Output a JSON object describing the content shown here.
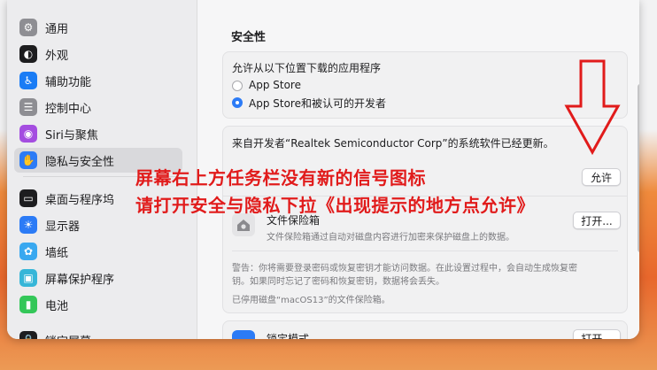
{
  "sidebar": {
    "items": [
      {
        "label": "通用",
        "icon": "gear-icon",
        "color": "#8e8e93"
      },
      {
        "label": "外观",
        "icon": "appearance-icon",
        "color": "#1d1d1f"
      },
      {
        "label": "辅助功能",
        "icon": "accessibility-icon",
        "color": "#1a7cf5"
      },
      {
        "label": "控制中心",
        "icon": "control-center-icon",
        "color": "#8e8e93"
      },
      {
        "label": "Siri与聚焦",
        "icon": "siri-icon",
        "color": "#a44de0"
      },
      {
        "label": "隐私与安全性",
        "icon": "privacy-hand-icon",
        "color": "#2c7bf6"
      },
      {
        "label": "桌面与程序坞",
        "icon": "dock-icon",
        "color": "#1d1d1f"
      },
      {
        "label": "显示器",
        "icon": "display-icon",
        "color": "#2c7bf6"
      },
      {
        "label": "墙纸",
        "icon": "wallpaper-icon",
        "color": "#39a8f0"
      },
      {
        "label": "屏幕保护程序",
        "icon": "screensaver-icon",
        "color": "#36b6d8"
      },
      {
        "label": "电池",
        "icon": "battery-icon",
        "color": "#34c759"
      },
      {
        "label": "锁定屏幕",
        "icon": "lock-screen-icon",
        "color": "#1d1d1f"
      }
    ]
  },
  "main": {
    "section_title": "安全性",
    "allow_apps_label": "允许从以下位置下载的应用程序",
    "option_app_store": "App Store",
    "option_app_store_identified": "App Store和被认可的开发者",
    "blocked_software_text": "来自开发者“Realtek Semiconductor Corp”的系统软件已经更新。",
    "allow_button": "允许",
    "filevault_title": "文件保险箱",
    "filevault_desc": "文件保险箱通过自动对磁盘内容进行加密来保护磁盘上的数据。",
    "filevault_button": "打开...",
    "warning_line1": "警告：你将需要登录密码或恢复密钥才能访问数据。在此设置过程中，会自动生成恢复密",
    "warning_line2": "钥。如果同时忘记了密码和恢复密钥，数据将会丢失。",
    "filevault_disabled": "已停用磁盘“macOS13”的文件保险箱。",
    "lockdown_title": "锁定模式",
    "lockdown_button": "打开..."
  },
  "annotation": {
    "line1": "屏幕右上方任务栏没有新的信号图标",
    "line2": "请打开安全与隐私下拉《出现提示的地方点允许》",
    "color": "#e11b1b"
  }
}
